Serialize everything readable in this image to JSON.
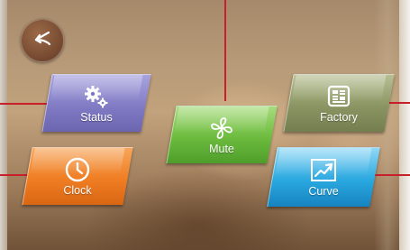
{
  "back": {
    "icon": "return-arrow-icon"
  },
  "tiles": {
    "status": {
      "label": "Status",
      "icon": "gears-icon",
      "color": "#7e78c2"
    },
    "clock": {
      "label": "Clock",
      "icon": "clock-icon",
      "color": "#ef7d23"
    },
    "mute": {
      "label": "Mute",
      "icon": "fan-icon",
      "color": "#6cbb3e"
    },
    "factory": {
      "label": "Factory",
      "icon": "control-panel-icon",
      "color": "#8b9563"
    },
    "curve": {
      "label": "Curve",
      "icon": "trend-chart-icon",
      "color": "#2aa8e0"
    }
  },
  "accent_line_color": "#c8202a"
}
